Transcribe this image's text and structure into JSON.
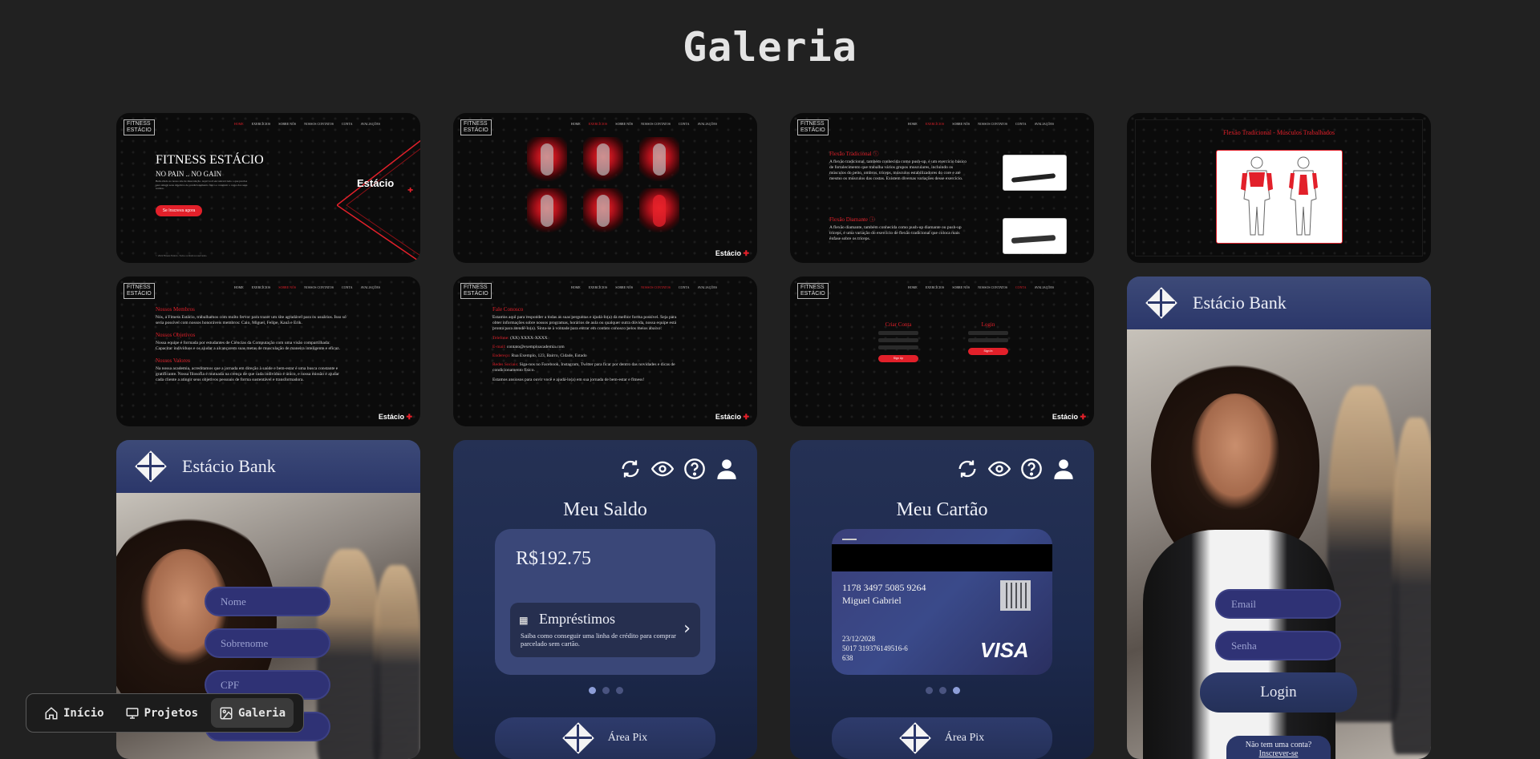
{
  "page": {
    "title": "Galeria"
  },
  "fitness": {
    "logo_line1": "FITNESS",
    "logo_line2": "ESTÁCIO",
    "nav": [
      "HOME",
      "EXERCÍCIOS",
      "SOBRE NÓS",
      "NOSSOS CONTATOS",
      "CONTA",
      "AVALIAÇÕES"
    ],
    "brand": "Estácio",
    "hero_title": "FITNESS ESTÁCIO",
    "hero_subtitle": "NO PAIN .. NO GAIN",
    "hero_text": "Bem-vindo ao nosso site de musculação. Aqui você encontrará tudo o que precisa para atingir seus objetivos de condicionamento físico e construir o corpo dos seus sonhos.",
    "hero_button": "Se Inscreva agora",
    "footer": "© 2024 Fitness Estácio. Todos os direitos reservados.",
    "ex_title1": "Flexão Tradicional ⓘ",
    "ex_text1": "A flexão tradicional, também conhecida como push-up, é um exercício básico de fortalecimento que trabalha vários grupos musculares, incluindo os músculos do peito, ombros, tríceps, músculos estabilizadores do core e até mesmo os músculos das costas. Existem diversas variações desse exercício.",
    "ex_title2": "Flexão Diamante ⓘ",
    "ex_text2": "A flexão diamante, também conhecida como push-up diamante ou push-up tríceps, é uma variação do exercício de flexão tradicional que coloca mais ênfase sobre os tríceps.",
    "muscles_title": "Flexão Tradicional - Músculos Trabalhados",
    "about_h1": "Nossos Membros",
    "about_t1": "Nós, a Fitness Estácio, trabalhamos com muito fervor para trazer um site agradável para os usuários. Isso só seria possível com nossos honoráveis membros: Caio, Miguel, Felipe, Kauã e Erik.",
    "about_h2": "Nossos Objetivos",
    "about_t2": "Nossa equipe é formada por estudantes de Ciências da Computação com uma visão compartilhada: Capacitar indivíduos e os ajudar a alcançarem suas metas de musculação de maneira inteligente e eficaz.",
    "about_h3": "Nossos Valores",
    "about_t3": "Na nossa academia, acreditamos que a jornada em direção à saúde e bem-estar é uma busca constante e gratificante. Nossa filosofia é mutuada na crença de que cada indivíduo é único, e nossa missão é ajudar cada cliente a atingir seus objetivos pessoais de forma sustentável e transformadora.",
    "contact_h": "Fale Conosco",
    "contact_t": "Estamos aqui para responder a todas as suas perguntas e ajudá-lo(a) da melhor forma possível. Seja para obter informações sobre nossos programas, horários de aula ou qualquer outra dúvida, nossa equipe está pronta para atendê-lo(a). Sinta-se à vontade para entrar em contato conosco pelos meios abaixo:",
    "contact_phone_l": "Telefone:",
    "contact_phone": "(XX) XXXX-XXXX",
    "contact_email_l": "E-mail:",
    "contact_email": "contato@exemploacademia.com",
    "contact_addr_l": "Endereço:",
    "contact_addr": "Rua Exemplo, 123, Bairro, Cidade, Estado",
    "contact_social_l": "Redes Sociais:",
    "contact_social": "Siga-nos no Facebook, Instagram, Twitter para ficar por dentro das novidades e dicas de condicionamento físico.",
    "contact_end": "Estamos ansiosos para ouvir você e ajudá-lo(a) em sua jornada de bem-estar e fitness!",
    "account_create": "Criar Conta",
    "account_login": "Login",
    "account_signup_btn": "Sign Up",
    "account_signin_btn": "Sign In"
  },
  "bank": {
    "name": "Estácio Bank",
    "register": {
      "nome": "Nome",
      "sobrenome": "Sobrenome",
      "cpf": "CPF"
    },
    "saldo_title": "Meu Saldo",
    "saldo_value": "R$192.75",
    "emprestimos_title": "Empréstimos",
    "emprestimos_text": "Saiba como conseguir uma linha de crédito para comprar parcelado sem cartão.",
    "pix": "Área Pix",
    "cartao_title": "Meu Cartão",
    "card_number": "1178 3497 5085 9264",
    "card_holder": "Miguel Gabriel",
    "card_expiry": "23/12/2028",
    "card_account": "5017 319376149516-6",
    "card_cvv": "638",
    "card_brand": "VISA",
    "login_email": "Email",
    "login_senha": "Senha",
    "login_button": "Login",
    "no_account": "Não tem uma conta?",
    "signup_link": "Inscrever-se"
  },
  "bottom_nav": [
    {
      "label": "Início",
      "icon": "home-icon"
    },
    {
      "label": "Projetos",
      "icon": "monitor-icon"
    },
    {
      "label": "Galeria",
      "icon": "gallery-icon"
    }
  ],
  "colors": {
    "accent_red": "#e2202a",
    "bank_navy": "#253154",
    "bank_button": "#2f3275"
  }
}
